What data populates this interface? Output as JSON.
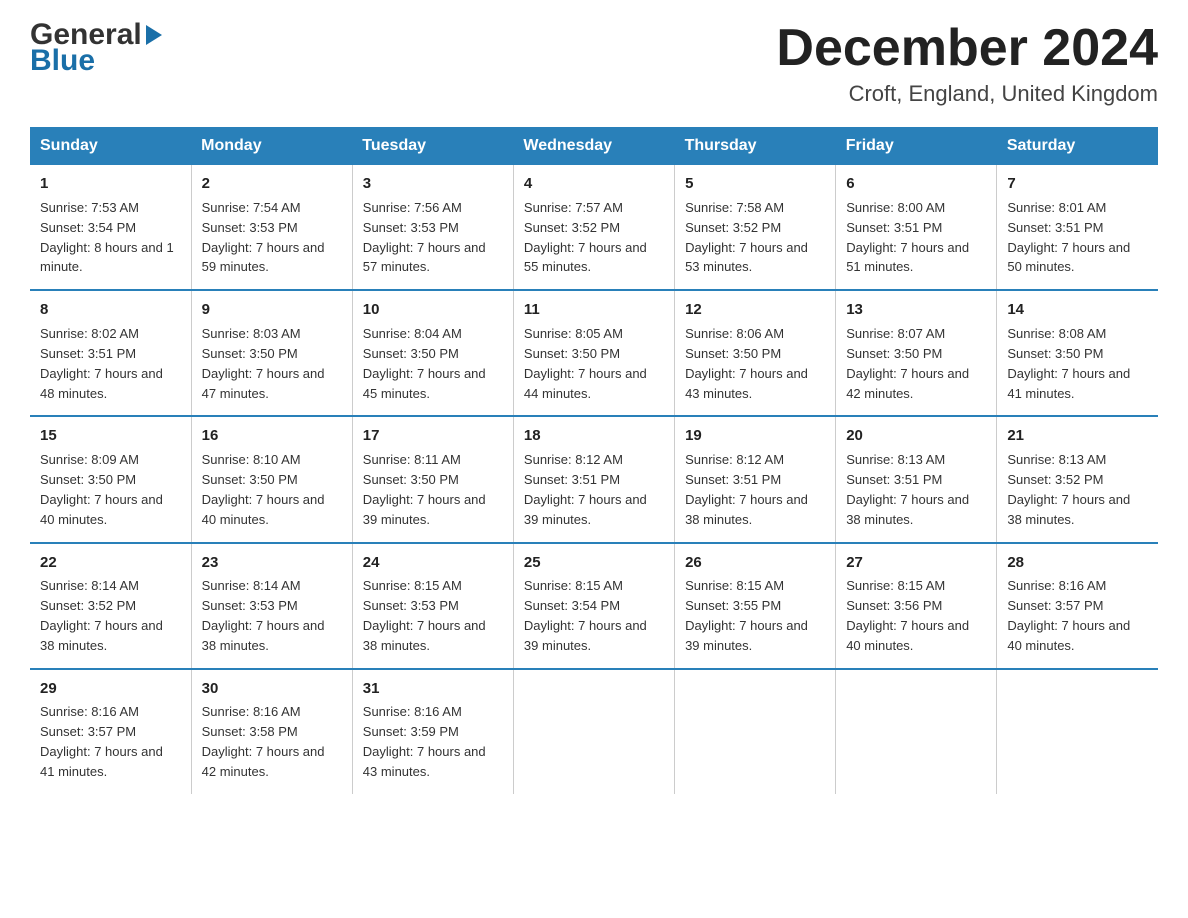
{
  "logo": {
    "general": "General",
    "blue": "Blue"
  },
  "title": "December 2024",
  "location": "Croft, England, United Kingdom",
  "days_of_week": [
    "Sunday",
    "Monday",
    "Tuesday",
    "Wednesday",
    "Thursday",
    "Friday",
    "Saturday"
  ],
  "weeks": [
    [
      {
        "num": "1",
        "sunrise": "7:53 AM",
        "sunset": "3:54 PM",
        "daylight": "8 hours and 1 minute."
      },
      {
        "num": "2",
        "sunrise": "7:54 AM",
        "sunset": "3:53 PM",
        "daylight": "7 hours and 59 minutes."
      },
      {
        "num": "3",
        "sunrise": "7:56 AM",
        "sunset": "3:53 PM",
        "daylight": "7 hours and 57 minutes."
      },
      {
        "num": "4",
        "sunrise": "7:57 AM",
        "sunset": "3:52 PM",
        "daylight": "7 hours and 55 minutes."
      },
      {
        "num": "5",
        "sunrise": "7:58 AM",
        "sunset": "3:52 PM",
        "daylight": "7 hours and 53 minutes."
      },
      {
        "num": "6",
        "sunrise": "8:00 AM",
        "sunset": "3:51 PM",
        "daylight": "7 hours and 51 minutes."
      },
      {
        "num": "7",
        "sunrise": "8:01 AM",
        "sunset": "3:51 PM",
        "daylight": "7 hours and 50 minutes."
      }
    ],
    [
      {
        "num": "8",
        "sunrise": "8:02 AM",
        "sunset": "3:51 PM",
        "daylight": "7 hours and 48 minutes."
      },
      {
        "num": "9",
        "sunrise": "8:03 AM",
        "sunset": "3:50 PM",
        "daylight": "7 hours and 47 minutes."
      },
      {
        "num": "10",
        "sunrise": "8:04 AM",
        "sunset": "3:50 PM",
        "daylight": "7 hours and 45 minutes."
      },
      {
        "num": "11",
        "sunrise": "8:05 AM",
        "sunset": "3:50 PM",
        "daylight": "7 hours and 44 minutes."
      },
      {
        "num": "12",
        "sunrise": "8:06 AM",
        "sunset": "3:50 PM",
        "daylight": "7 hours and 43 minutes."
      },
      {
        "num": "13",
        "sunrise": "8:07 AM",
        "sunset": "3:50 PM",
        "daylight": "7 hours and 42 minutes."
      },
      {
        "num": "14",
        "sunrise": "8:08 AM",
        "sunset": "3:50 PM",
        "daylight": "7 hours and 41 minutes."
      }
    ],
    [
      {
        "num": "15",
        "sunrise": "8:09 AM",
        "sunset": "3:50 PM",
        "daylight": "7 hours and 40 minutes."
      },
      {
        "num": "16",
        "sunrise": "8:10 AM",
        "sunset": "3:50 PM",
        "daylight": "7 hours and 40 minutes."
      },
      {
        "num": "17",
        "sunrise": "8:11 AM",
        "sunset": "3:50 PM",
        "daylight": "7 hours and 39 minutes."
      },
      {
        "num": "18",
        "sunrise": "8:12 AM",
        "sunset": "3:51 PM",
        "daylight": "7 hours and 39 minutes."
      },
      {
        "num": "19",
        "sunrise": "8:12 AM",
        "sunset": "3:51 PM",
        "daylight": "7 hours and 38 minutes."
      },
      {
        "num": "20",
        "sunrise": "8:13 AM",
        "sunset": "3:51 PM",
        "daylight": "7 hours and 38 minutes."
      },
      {
        "num": "21",
        "sunrise": "8:13 AM",
        "sunset": "3:52 PM",
        "daylight": "7 hours and 38 minutes."
      }
    ],
    [
      {
        "num": "22",
        "sunrise": "8:14 AM",
        "sunset": "3:52 PM",
        "daylight": "7 hours and 38 minutes."
      },
      {
        "num": "23",
        "sunrise": "8:14 AM",
        "sunset": "3:53 PM",
        "daylight": "7 hours and 38 minutes."
      },
      {
        "num": "24",
        "sunrise": "8:15 AM",
        "sunset": "3:53 PM",
        "daylight": "7 hours and 38 minutes."
      },
      {
        "num": "25",
        "sunrise": "8:15 AM",
        "sunset": "3:54 PM",
        "daylight": "7 hours and 39 minutes."
      },
      {
        "num": "26",
        "sunrise": "8:15 AM",
        "sunset": "3:55 PM",
        "daylight": "7 hours and 39 minutes."
      },
      {
        "num": "27",
        "sunrise": "8:15 AM",
        "sunset": "3:56 PM",
        "daylight": "7 hours and 40 minutes."
      },
      {
        "num": "28",
        "sunrise": "8:16 AM",
        "sunset": "3:57 PM",
        "daylight": "7 hours and 40 minutes."
      }
    ],
    [
      {
        "num": "29",
        "sunrise": "8:16 AM",
        "sunset": "3:57 PM",
        "daylight": "7 hours and 41 minutes."
      },
      {
        "num": "30",
        "sunrise": "8:16 AM",
        "sunset": "3:58 PM",
        "daylight": "7 hours and 42 minutes."
      },
      {
        "num": "31",
        "sunrise": "8:16 AM",
        "sunset": "3:59 PM",
        "daylight": "7 hours and 43 minutes."
      },
      null,
      null,
      null,
      null
    ]
  ]
}
